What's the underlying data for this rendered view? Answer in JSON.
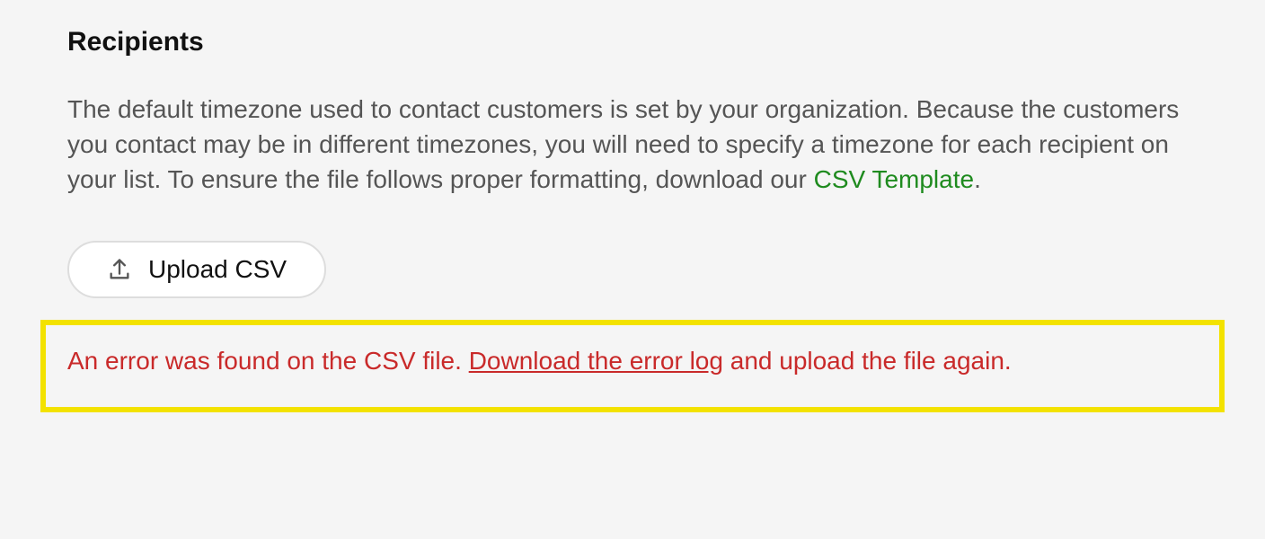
{
  "section": {
    "heading": "Recipients",
    "description_part1": "The default timezone used to contact customers is set by your organization. Because the customers you contact may be in different timezones, you will need to specify a timezone for each recipient on your list. To ensure the file follows proper formatting, download our ",
    "template_link": "CSV Template",
    "description_part2": ".",
    "upload_button_label": "Upload CSV",
    "error_prefix": "An error was found on the CSV file. ",
    "error_link": "Download the error log",
    "error_suffix": " and upload the file again."
  }
}
